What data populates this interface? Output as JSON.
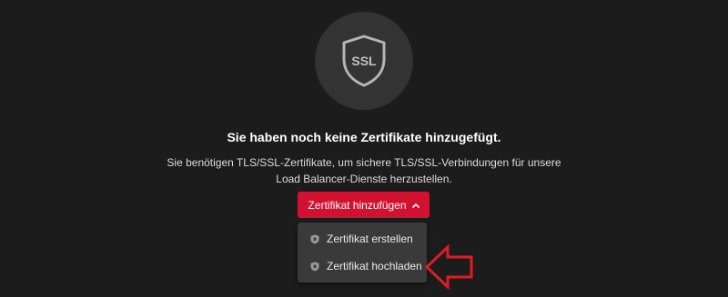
{
  "empty_state": {
    "badge_icon": "ssl-shield-icon",
    "badge_text": "SSL",
    "headline": "Sie haben noch keine Zertifikate hinzugefügt.",
    "description_line1": "Sie benötigen TLS/SSL-Zertifikate, um sichere TLS/SSL-Verbindungen für unsere",
    "description_line2": "Load Balancer-Dienste herzustellen."
  },
  "add_button": {
    "label": "Zertifikat hinzufügen",
    "icon": "chevron-up-icon"
  },
  "dropdown": {
    "items": [
      {
        "label": "Zertifikat erstellen",
        "icon": "shield-icon"
      },
      {
        "label": "Zertifikat hochladen",
        "icon": "shield-icon"
      }
    ]
  },
  "annotation": {
    "icon": "red-arrow-icon",
    "color": "#e01b24"
  },
  "colors": {
    "background": "#1c1c1c",
    "accent": "#d2102f",
    "menu_bg": "#3a3a3a"
  }
}
